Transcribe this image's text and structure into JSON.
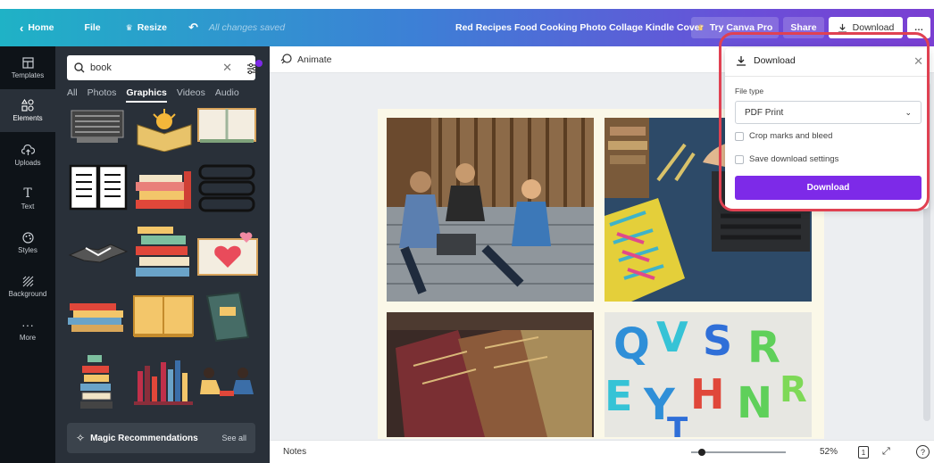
{
  "topbar": {
    "home": "Home",
    "file": "File",
    "resize": "Resize",
    "saved_status": "All changes saved",
    "title": "Red Recipes Food Cooking Photo Collage Kindle Cover",
    "try_pro": "Try Canva Pro",
    "share": "Share",
    "download": "Download"
  },
  "rail": [
    {
      "label": "Templates",
      "icon": "templates-icon"
    },
    {
      "label": "Elements",
      "icon": "elements-icon"
    },
    {
      "label": "Uploads",
      "icon": "uploads-icon"
    },
    {
      "label": "Text",
      "icon": "text-icon"
    },
    {
      "label": "Styles",
      "icon": "styles-icon"
    },
    {
      "label": "Background",
      "icon": "background-icon"
    },
    {
      "label": "More",
      "icon": "more-icon"
    }
  ],
  "panel": {
    "search_value": "book",
    "tabs": [
      "All",
      "Photos",
      "Graphics",
      "Videos",
      "Audio"
    ],
    "active_tab": "Graphics",
    "magic_label": "Magic Recommendations",
    "see_all": "See all"
  },
  "canvas": {
    "animate": "Animate",
    "notes": "Notes",
    "zoom": "52%",
    "page_number": "1"
  },
  "download_popup": {
    "title": "Download",
    "file_type_label": "File type",
    "file_type_value": "PDF Print",
    "crop_marks": "Crop marks and bleed",
    "save_settings": "Save download settings",
    "button": "Download"
  },
  "colors": {
    "accent": "#7d2ae8",
    "highlight_ring": "#e04152",
    "panel_bg": "#293039",
    "rail_bg": "#0e1318"
  }
}
